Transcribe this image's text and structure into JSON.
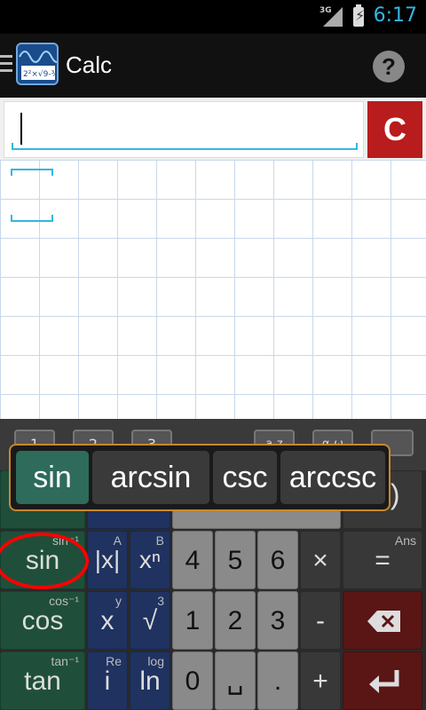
{
  "status_bar": {
    "network": "3G",
    "time": "6:17"
  },
  "action_bar": {
    "title": "Calc",
    "help": "?"
  },
  "input": {
    "value": "",
    "clear_label": "C"
  },
  "tabs": [
    "1",
    "2",
    "3",
    "a-z",
    "α-ω",
    ""
  ],
  "keys": {
    "sin": {
      "label": "sin",
      "sup": "sin⁻¹"
    },
    "abs": {
      "label": "|x|",
      "sup": "A"
    },
    "pow": {
      "label": "xⁿ",
      "sup": "B"
    },
    "cos": {
      "label": "cos",
      "sup": "cos⁻¹"
    },
    "x": {
      "label": "x",
      "sup": "y"
    },
    "sqrt": {
      "label": "√",
      "sup": "3"
    },
    "tan": {
      "label": "tan",
      "sup": "tan⁻¹"
    },
    "i": {
      "label": "i",
      "sup": "Re"
    },
    "ln": {
      "label": "ln",
      "sup": "log"
    },
    "d4": "4",
    "d5": "5",
    "d6": "6",
    "d1": "1",
    "d2": "2",
    "d3": "3",
    "d0": "0",
    "space": "␣",
    "dot": ".",
    "mul": "×",
    "minus": "-",
    "plus": "+",
    "equals": {
      "label": "=",
      "sup": "Ans"
    },
    "paren_close": ")",
    "paren_open": "("
  },
  "popup": [
    "sin",
    "arcsin",
    "csc",
    "arccsc"
  ],
  "colors": {
    "accent": "#33b5e5",
    "clear": "#b81c1c",
    "popup_border": "#c8872c",
    "highlight": "#ff0000"
  }
}
